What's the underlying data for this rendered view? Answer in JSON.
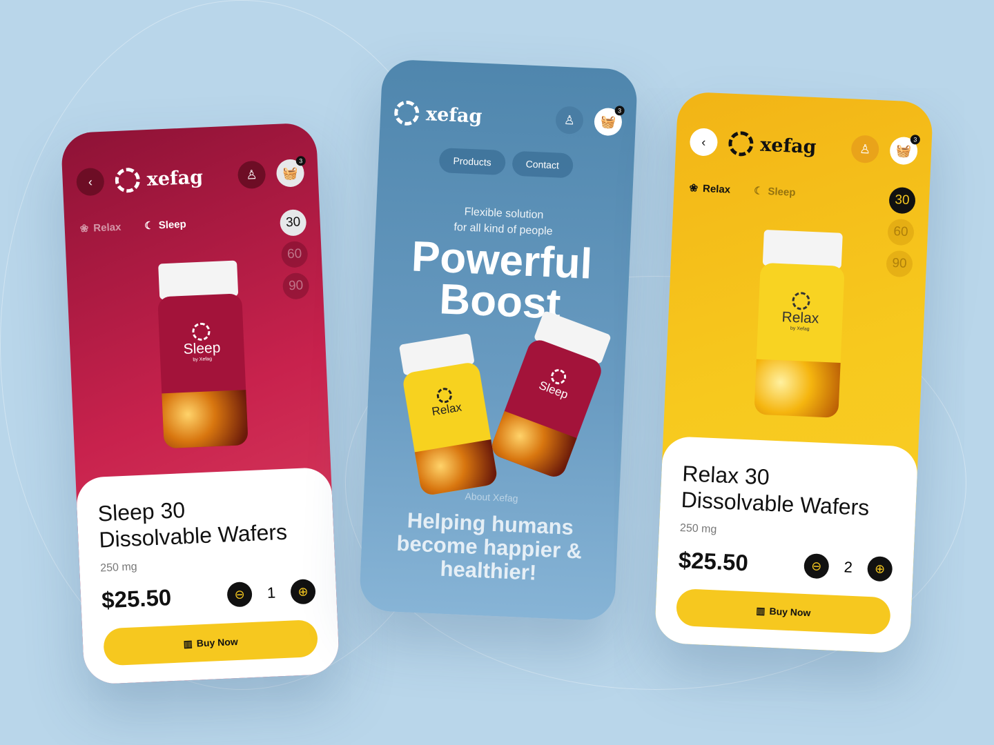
{
  "brand": "xefag",
  "colors": {
    "background": "#b9d6ea",
    "red": "#c8224d",
    "blue": "#5a8fb8",
    "yellow": "#f6c81f",
    "accent": "#f6c81f"
  },
  "cart_count": "3",
  "icons": {
    "back": "chevron-left-icon",
    "user": "user-icon",
    "cart": "basket-icon",
    "relax": "lotus-icon",
    "sleep": "moon-icon",
    "minus": "minus-icon",
    "plus": "plus-icon",
    "buy": "barcode-icon"
  },
  "tabs": {
    "relax": "Relax",
    "sleep": "Sleep"
  },
  "sizes": [
    "30",
    "60",
    "90"
  ],
  "bottle": {
    "by": "by Xefag",
    "mg": "250 mg",
    "count": "30"
  },
  "left": {
    "bottle_label": "Sleep",
    "title_line1": "Sleep 30",
    "title_line2": "Dissolvable Wafers",
    "mg": "250 mg",
    "price": "$25.50",
    "qty": "1",
    "buy": "Buy Now",
    "selected_size": "30",
    "active_tab": "Sleep"
  },
  "middle": {
    "nav": [
      "Products",
      "Contact"
    ],
    "tagline1": "Flexible solution",
    "tagline2": "for all kind of people",
    "headline1": "Powerful",
    "headline2": "Boost",
    "about": "About Xefag",
    "mission1": "Helping humans",
    "mission2": "become happier &",
    "mission3": "healthier!",
    "bottles": [
      "Relax",
      "Sleep"
    ]
  },
  "right": {
    "bottle_label": "Relax",
    "title_line1": "Relax 30",
    "title_line2": "Dissolvable Wafers",
    "mg": "250 mg",
    "price": "$25.50",
    "qty": "2",
    "buy": "Buy Now",
    "selected_size": "30",
    "active_tab": "Relax"
  }
}
